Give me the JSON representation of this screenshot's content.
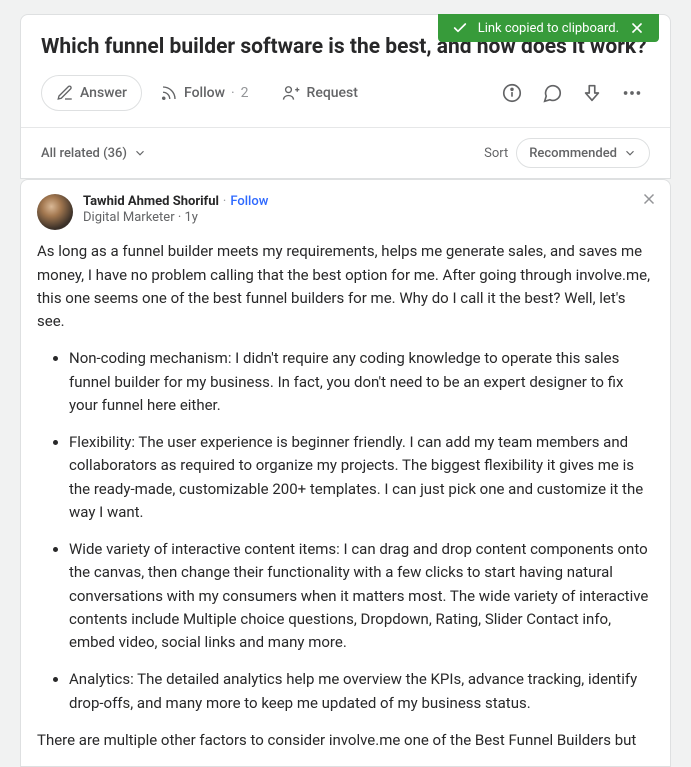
{
  "toast": {
    "text": "Link copied to clipboard."
  },
  "question": {
    "title": "Which funnel builder software is the best, and how does it work?"
  },
  "actions": {
    "answer": "Answer",
    "follow": "Follow",
    "follow_count": "2",
    "request": "Request"
  },
  "filter": {
    "all_related": "All related (36)",
    "sort_label": "Sort",
    "sort_value": "Recommended"
  },
  "answer": {
    "author": "Tawhid Ahmed Shoriful",
    "follow": "Follow",
    "credential": "Digital Marketer",
    "time": "1y",
    "intro": "As long as a funnel builder meets my requirements, helps me generate sales, and saves me money, I have no problem calling that the best option for me. After going through involve.me, this one seems one of the best funnel builders for me. Why do I call it the best? Well, let's see.",
    "bullets": [
      "Non-coding mechanism: I didn't require any coding knowledge to operate this sales funnel builder for my business. In fact, you don't need to be an expert designer to fix your funnel here either.",
      "Flexibility: The user experience is beginner friendly. I can add my team members and collaborators as required to organize my projects. The biggest flexibility it gives me is the ready-made, customizable 200+ templates. I can just pick one and customize it the way I want.",
      "Wide variety of interactive content items: I can drag and drop content components onto the canvas, then change their functionality with a few clicks to start having natural conversations with my consumers when it matters most. The wide variety of interactive contents include Multiple choice questions, Dropdown, Rating, Slider Contact info, embed video, social links and many more.",
      "Analytics: The detailed analytics help me overview the KPIs, advance tracking, identify drop-offs, and many more to keep me updated of my business status."
    ],
    "outro": "There are multiple other factors to consider involve.me one of the Best Funnel Builders but"
  }
}
